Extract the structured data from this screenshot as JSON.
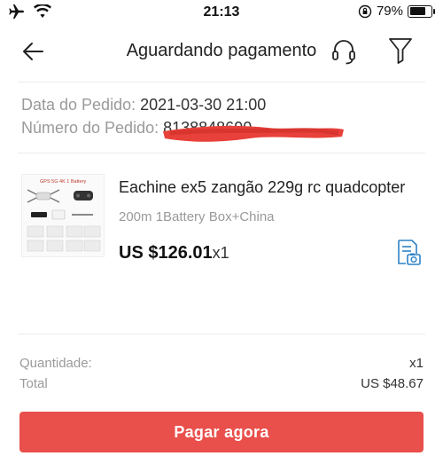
{
  "status_bar": {
    "time": "21:13",
    "battery": "79%",
    "battery_level": 0.79
  },
  "nav": {
    "title": "Aguardando pagamento",
    "icons": [
      "back-arrow-icon",
      "headset-support-icon",
      "filter-icon"
    ]
  },
  "order": {
    "date_label": "Data do Pedido:",
    "date_value": "2021-03-30 21:00",
    "number_label": "Número do Pedido:",
    "number_value": "8138848690..."
  },
  "product": {
    "title": "Eachine ex5 zangão 229g rc quadcopter",
    "variant": "200m 1Battery Box+China",
    "price": "US $126.01",
    "quantity": "x1",
    "image_caption": "GPS 5G 4K 1 Battery"
  },
  "summary": {
    "quantity_label": "Quantidade:",
    "quantity_value": "x1",
    "total_label": "Total",
    "total_value": "US $48.67"
  },
  "actions": {
    "pay_label": "Pagar agora",
    "pay_color": "#e94f4b"
  }
}
